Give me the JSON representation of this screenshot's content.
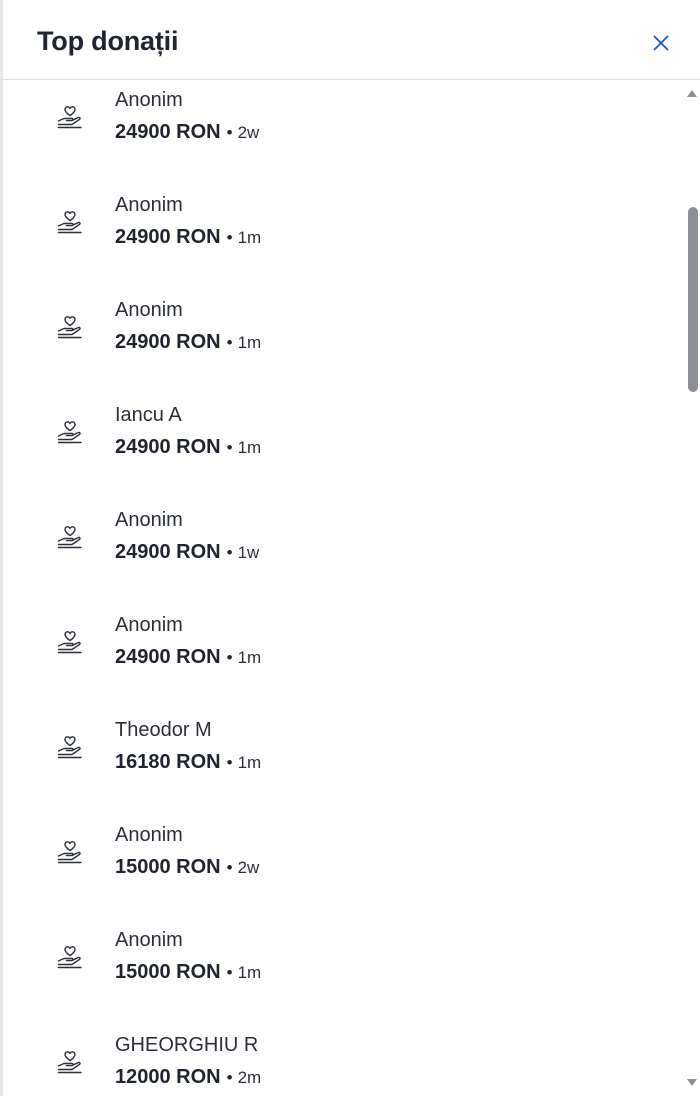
{
  "dialog": {
    "title": "Top donații",
    "close_icon": "close-icon"
  },
  "donations": [
    {
      "name": "Anonim",
      "amount": "24900 RON",
      "separator": "•",
      "ago": "2w",
      "icon": "donation-hand-heart-icon"
    },
    {
      "name": "Anonim",
      "amount": "24900 RON",
      "separator": "•",
      "ago": "1m",
      "icon": "donation-hand-heart-icon"
    },
    {
      "name": "Anonim",
      "amount": "24900 RON",
      "separator": "•",
      "ago": "1m",
      "icon": "donation-hand-heart-icon"
    },
    {
      "name": "Iancu A",
      "amount": "24900 RON",
      "separator": "•",
      "ago": "1m",
      "icon": "donation-hand-heart-icon"
    },
    {
      "name": "Anonim",
      "amount": "24900 RON",
      "separator": "•",
      "ago": "1w",
      "icon": "donation-hand-heart-icon"
    },
    {
      "name": "Anonim",
      "amount": "24900 RON",
      "separator": "•",
      "ago": "1m",
      "icon": "donation-hand-heart-icon"
    },
    {
      "name": "Theodor M",
      "amount": "16180 RON",
      "separator": "•",
      "ago": "1m",
      "icon": "donation-hand-heart-icon"
    },
    {
      "name": "Anonim",
      "amount": "15000 RON",
      "separator": "•",
      "ago": "2w",
      "icon": "donation-hand-heart-icon"
    },
    {
      "name": "Anonim",
      "amount": "15000 RON",
      "separator": "•",
      "ago": "1m",
      "icon": "donation-hand-heart-icon"
    },
    {
      "name": "GHEORGHIU R",
      "amount": "12000 RON",
      "separator": "•",
      "ago": "2m",
      "icon": "donation-hand-heart-icon"
    }
  ],
  "colors": {
    "accent": "#1a56db",
    "text": "#1f2430"
  }
}
